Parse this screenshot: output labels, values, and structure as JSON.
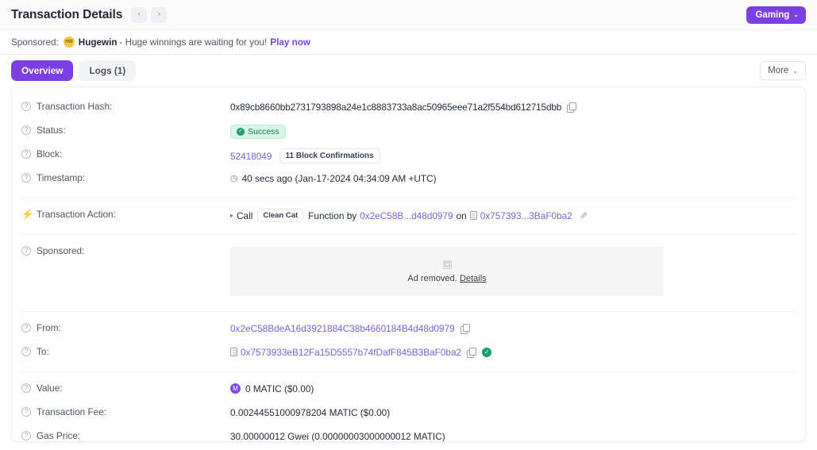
{
  "header": {
    "title": "Transaction Details",
    "prev_arrow": "‹",
    "next_arrow": "›",
    "gaming_label": "Gaming",
    "caret": "⌄"
  },
  "sponsored_bar": {
    "label": "Sponsored:",
    "logo_text": "HW",
    "brand": "Hugewin",
    "text": "- Huge winnings are waiting for you!",
    "cta": "Play now"
  },
  "tabs": {
    "overview": "Overview",
    "logs": "Logs (1)",
    "more": "More",
    "caret": "⌄"
  },
  "details": {
    "labels": {
      "transaction_hash": "Transaction Hash:",
      "status": "Status:",
      "block": "Block:",
      "timestamp": "Timestamp:",
      "transaction_action": "Transaction Action:",
      "sponsored": "Sponsored:",
      "from": "From:",
      "to": "To:",
      "value": "Value:",
      "transaction_fee": "Transaction Fee:",
      "gas_price": "Gas Price:"
    },
    "transaction_hash": "0x89cb8660bb2731793898a24e1c8883733a8ac50965eee71a2f554bd612715dbb",
    "status": "Success",
    "block_number": "52418049",
    "block_confirmations": "11 Block Confirmations",
    "timestamp": "40 secs ago (Jan-17-2024 04:34:09 AM +UTC)",
    "action": {
      "call_word": "Call",
      "method": "Clean Cat",
      "function_by": "Function by",
      "caller_address": "0x2eC58B...d48d0979",
      "on_word": "on",
      "contract_address": "0x757393...3BaF0ba2"
    },
    "ad": {
      "removed_text": "Ad removed.",
      "details_link": "Details"
    },
    "from_address": "0x2eC58BdeA16d3921884C38b4660184B4d48d0979",
    "to_address": "0x7573933eB12Fa15D5557b74fDafF845B3BaF0ba2",
    "value": "0 MATIC ($0.00)",
    "value_token_symbol": "M",
    "transaction_fee": "0.00244551000978204 MATIC ($0.00)",
    "gas_price": "30.00000012 Gwei (0.00000003000000012 MATIC)"
  },
  "icons": {
    "question": "?",
    "bolt": "⚡",
    "clock": "🕐",
    "check": "✓",
    "caret_right": "▸",
    "pencil": "✎"
  },
  "colors": {
    "accent_purple": "#7b3fe4",
    "link_purple": "#7b61d8",
    "success_green": "#14a06a",
    "matic_purple": "#8247e5"
  }
}
